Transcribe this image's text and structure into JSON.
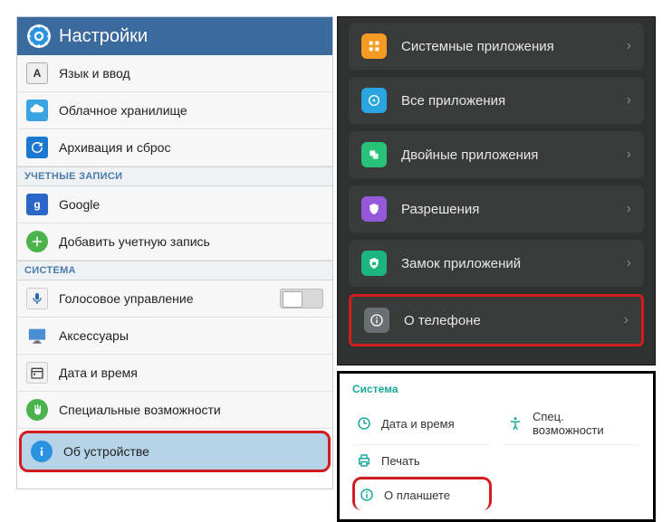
{
  "left": {
    "title": "Настройки",
    "items": [
      {
        "label": "Язык и ввод"
      },
      {
        "label": "Облачное хранилище"
      },
      {
        "label": "Архивация и сброс"
      }
    ],
    "section_accounts": "УЧЕТНЫЕ ЗАПИСИ",
    "accounts": [
      {
        "label": "Google"
      },
      {
        "label": "Добавить учетную запись"
      }
    ],
    "section_system": "СИСТЕМА",
    "system": [
      {
        "label": "Голосовое управление"
      },
      {
        "label": "Аксессуары"
      },
      {
        "label": "Дата и время"
      },
      {
        "label": "Специальные возможности"
      },
      {
        "label": "Об устройстве"
      }
    ]
  },
  "dark": {
    "items": [
      {
        "label": "Системные приложения"
      },
      {
        "label": "Все приложения"
      },
      {
        "label": "Двойные приложения"
      },
      {
        "label": "Разрешения"
      },
      {
        "label": "Замок приложений"
      },
      {
        "label": "О телефоне"
      }
    ]
  },
  "light": {
    "header": "Система",
    "row1": [
      {
        "label": "Дата и время"
      },
      {
        "label": "Спец. возможности"
      }
    ],
    "row2": [
      {
        "label": "Печать"
      },
      {
        "label": ""
      }
    ],
    "row3": [
      {
        "label": "О планшете"
      },
      {
        "label": ""
      }
    ]
  }
}
